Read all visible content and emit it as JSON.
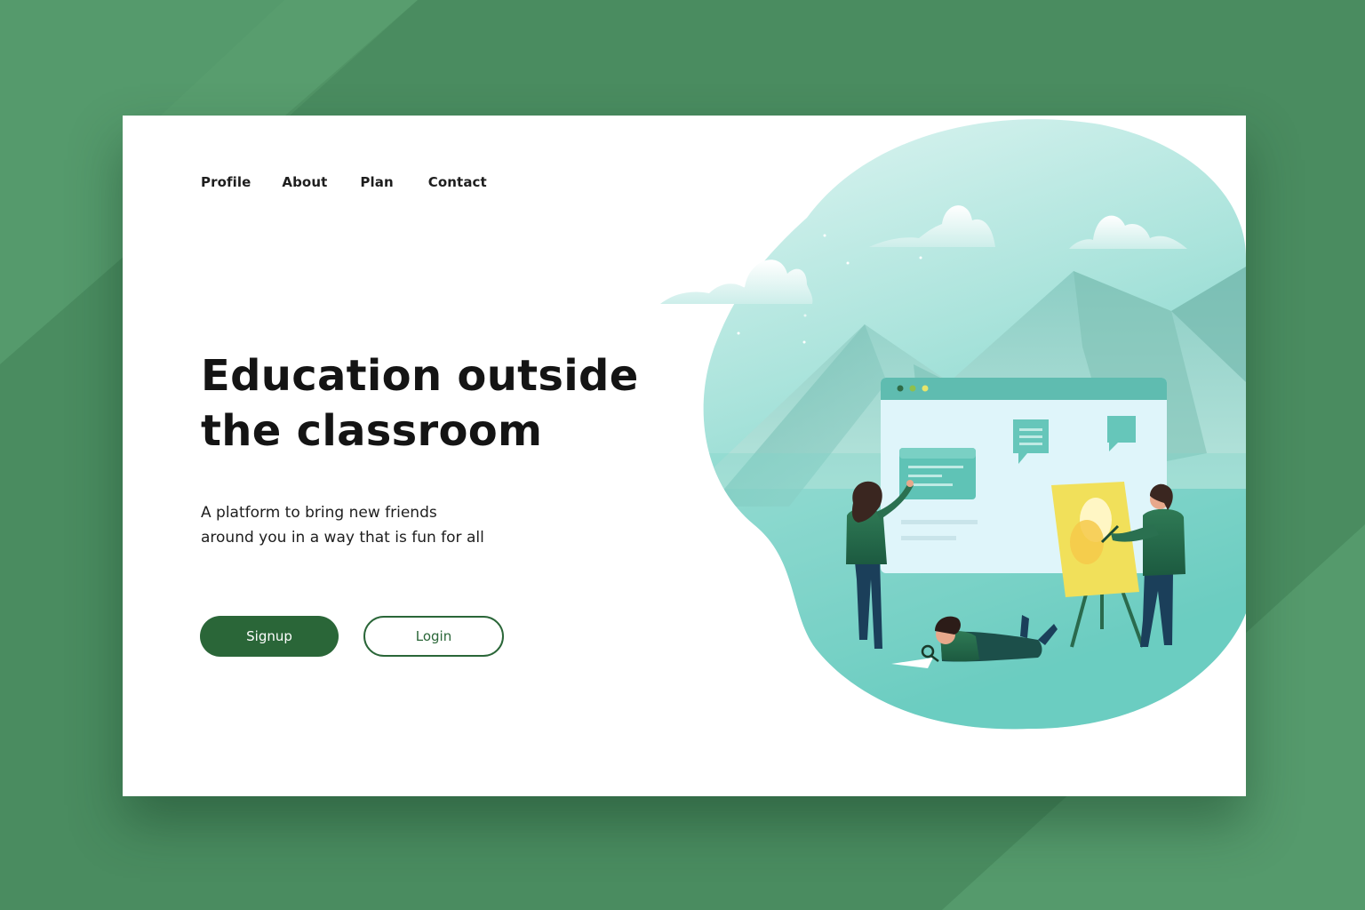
{
  "nav": {
    "items": [
      {
        "label": "Profile"
      },
      {
        "label": "About"
      },
      {
        "label": "Plan"
      },
      {
        "label": "Contact"
      }
    ]
  },
  "hero": {
    "headline_line1": "Education outside",
    "headline_line2": "the classroom",
    "subtitle_line1": "A platform to bring new friends",
    "subtitle_line2": "around you in a way that is fun for all"
  },
  "actions": {
    "signup_label": "Signup",
    "login_label": "Login"
  },
  "colors": {
    "background": "#4a8c60",
    "primary": "#2a6638",
    "illustration_teal": "#6ccfc4",
    "easel_yellow": "#f1e05a"
  }
}
